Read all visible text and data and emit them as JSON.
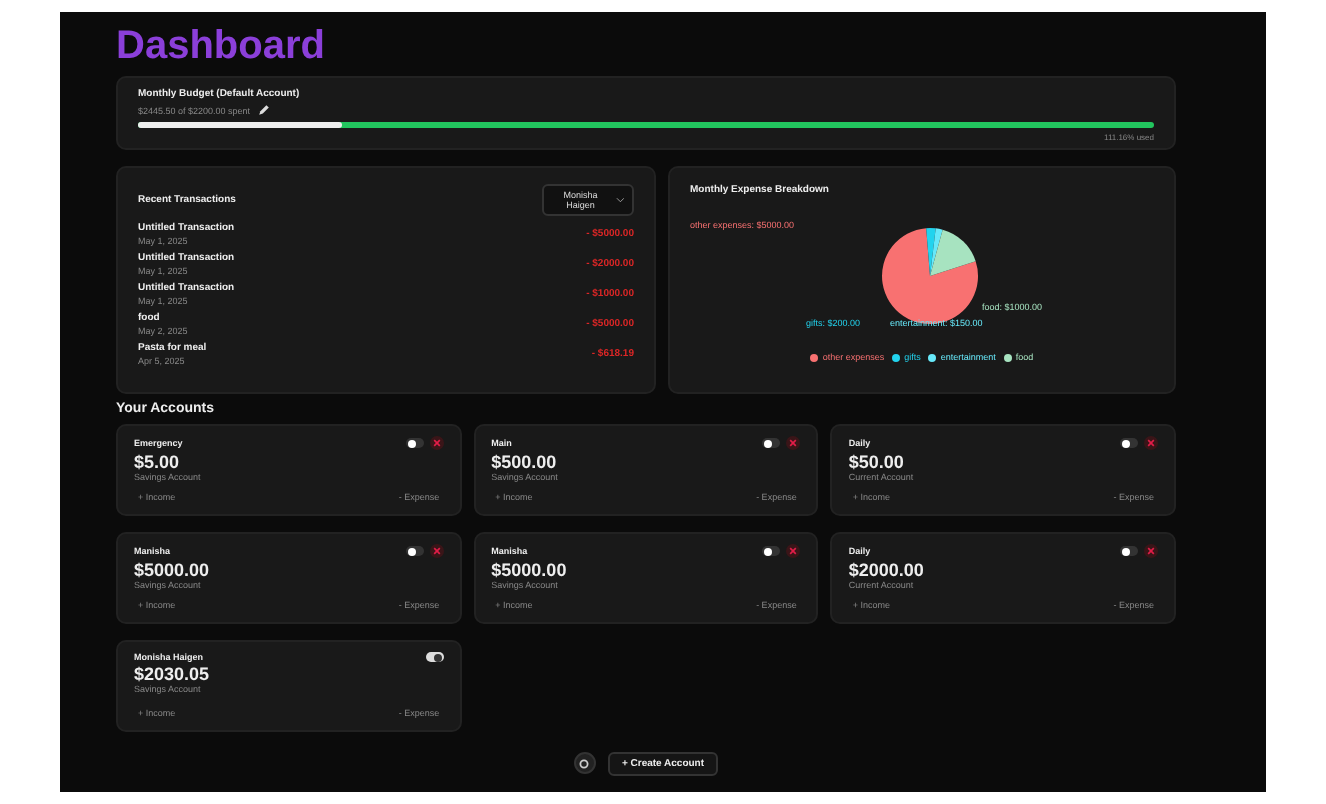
{
  "title": "Dashboard",
  "budget": {
    "title": "Monthly Budget (Default Account)",
    "summary": "$2445.50 of $2200.00 spent",
    "level": 0.2,
    "used": "111.16% used"
  },
  "transactions": {
    "title": "Recent Transactions",
    "account_select": "Monisha Haigen",
    "items": [
      {
        "name": "Untitled Transaction",
        "date": "May 1, 2025",
        "amount": "- $5000.00"
      },
      {
        "name": "Untitled Transaction",
        "date": "May 1, 2025",
        "amount": "- $2000.00"
      },
      {
        "name": "Untitled Transaction",
        "date": "May 1, 2025",
        "amount": "- $1000.00"
      },
      {
        "name": "food",
        "date": "May 2, 2025",
        "amount": "- $5000.00"
      },
      {
        "name": "Pasta for meal",
        "date": "Apr 5, 2025",
        "amount": "- $618.19"
      }
    ]
  },
  "expenses": {
    "title": "Monthly Expense Breakdown",
    "slice_labels": [
      "other expenses: $5000.00",
      "gifts: $200.00",
      "entertainment: $150.00",
      "food: $1000.00"
    ],
    "chart_data": {
      "type": "pie",
      "categories": [
        "other expenses",
        "gifts",
        "entertainment",
        "food"
      ],
      "values": [
        78.74,
        3.15,
        2.36,
        15.75
      ],
      "colors": [
        "#f87171",
        "#22d3ee",
        "#67e8f9",
        "#a7e3c0"
      ]
    }
  },
  "accounts_title": "Your Accounts",
  "accounts": [
    {
      "name": "Emergency",
      "balance": "$5.00",
      "type": "Savings Account",
      "on": false,
      "income": "+ Income",
      "expense": "- Expense"
    },
    {
      "name": "Main",
      "balance": "$500.00",
      "type": "Savings Account",
      "on": false,
      "income": "+ Income",
      "expense": "- Expense"
    },
    {
      "name": "Daily",
      "balance": "$50.00",
      "type": "Current Account",
      "on": false,
      "income": "+ Income",
      "expense": "- Expense"
    },
    {
      "name": "Manisha",
      "balance": "$5000.00",
      "type": "Savings Account",
      "on": false,
      "income": "+ Income",
      "expense": "- Expense"
    },
    {
      "name": "Manisha",
      "balance": "$5000.00",
      "type": "Savings Account",
      "on": false,
      "income": "+ Income",
      "expense": "- Expense"
    },
    {
      "name": "Daily",
      "balance": "$2000.00",
      "type": "Current Account",
      "on": false,
      "income": "+ Income",
      "expense": "- Expense"
    },
    {
      "name": "Monisha Haigen",
      "balance": "$2030.05",
      "type": "Savings Account",
      "on": true,
      "income": "+ Income",
      "expense": "- Expense"
    }
  ],
  "create_button": "+ Create Account"
}
